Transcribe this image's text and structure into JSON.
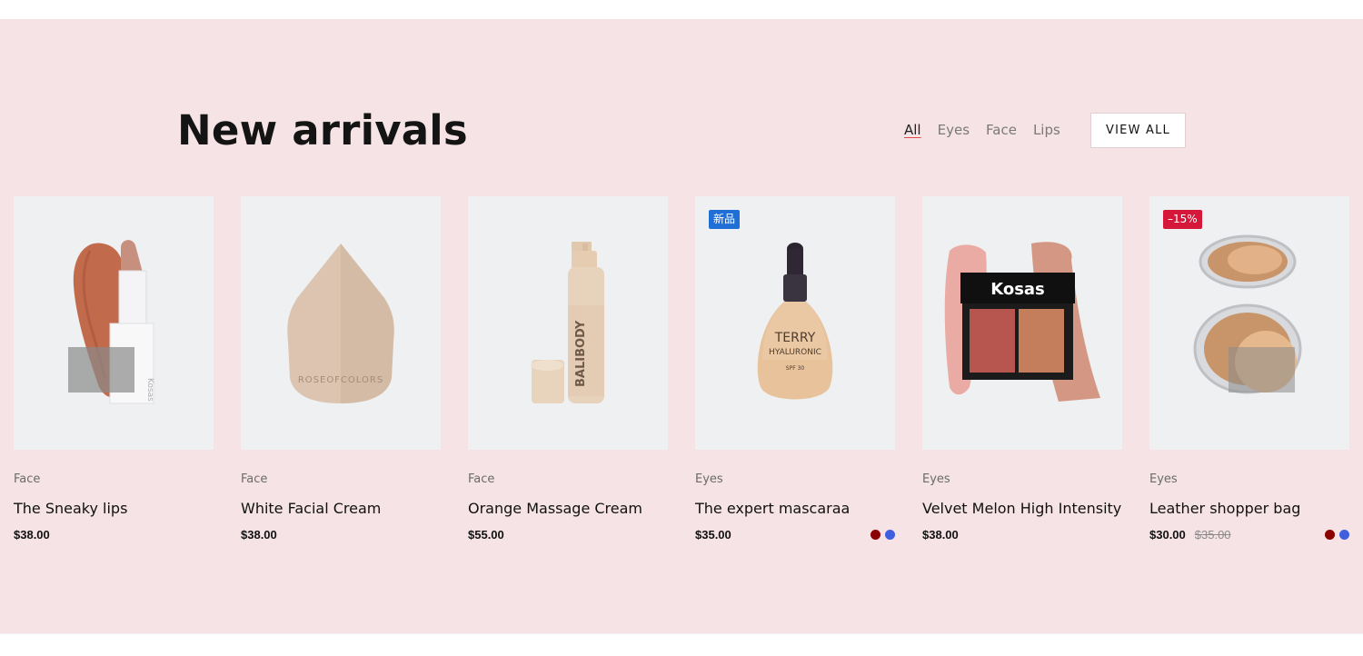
{
  "section": {
    "title": "New arrivals",
    "filters": [
      {
        "label": "All",
        "active": true
      },
      {
        "label": "Eyes",
        "active": false
      },
      {
        "label": "Face",
        "active": false
      },
      {
        "label": "Lips",
        "active": false
      }
    ],
    "view_all_label": "VIEW ALL",
    "background_color": "#f5e3e5"
  },
  "products": [
    {
      "category": "Face",
      "name": "The Sneaky lips",
      "price": "$38.00",
      "compare_price": "",
      "badge": "",
      "swatches": [],
      "image_icon": "lipstick-image"
    },
    {
      "category": "Face",
      "name": "White Facial Cream",
      "price": "$38.00",
      "compare_price": "",
      "badge": "",
      "swatches": [],
      "image_icon": "sponge-image"
    },
    {
      "category": "Face",
      "name": "Orange Massage Cream",
      "price": "$55.00",
      "compare_price": "",
      "badge": "",
      "swatches": [],
      "image_icon": "pump-bottle-image"
    },
    {
      "category": "Eyes",
      "name": "The expert mascaraa",
      "price": "$35.00",
      "compare_price": "",
      "badge": "新品",
      "badge_color": "#1f6fd6",
      "swatches": [
        "#8b0000",
        "#3f5fde"
      ],
      "image_icon": "foundation-bottle-image"
    },
    {
      "category": "Eyes",
      "name": "Velvet Melon High Intensity",
      "price": "$38.00",
      "compare_price": "",
      "badge": "",
      "swatches": [],
      "image_icon": "blush-palette-image"
    },
    {
      "category": "Eyes",
      "name": "Leather shopper bag",
      "price": "$30.00",
      "compare_price": "$35.00",
      "badge": "–15%",
      "badge_color": "#d5173a",
      "swatches": [
        "#8b0000",
        "#3f5fde"
      ],
      "image_icon": "compact-powder-image"
    }
  ],
  "product_image_text": {
    "sponge_brand": "ROSEOFCOLORS",
    "bottle_brand": "BALIBODY",
    "foundation_brand": "TERRY",
    "foundation_line1": "HYALURONIC",
    "foundation_line2": "SPF 30",
    "palette_brand": "Kosas",
    "lipstick_brand": "Kosas"
  }
}
